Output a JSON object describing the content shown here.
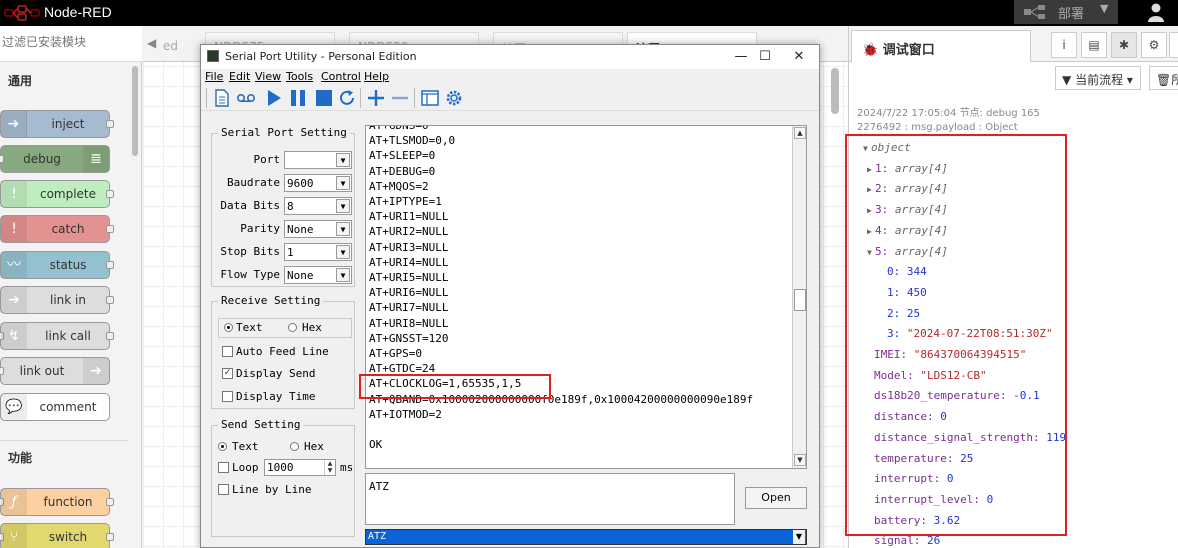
{
  "app": {
    "title": "Node-RED",
    "deploy_label": "部署"
  },
  "palette": {
    "search_placeholder": "过滤已安装模块",
    "categories": [
      "通用",
      "功能"
    ],
    "nodes": [
      {
        "label": "inject",
        "color": "#a6bbcf"
      },
      {
        "label": "debug",
        "color": "#87a980"
      },
      {
        "label": "complete",
        "color": "#c0edc0"
      },
      {
        "label": "catch",
        "color": "#e49191"
      },
      {
        "label": "status",
        "color": "#94c1d0"
      },
      {
        "label": "link in",
        "color": "#dddddd"
      },
      {
        "label": "link call",
        "color": "#dddddd"
      },
      {
        "label": "link out",
        "color": "#dddddd"
      },
      {
        "label": "comment",
        "color": "#ffffff"
      },
      {
        "label": "function",
        "color": "#fdd0a2"
      },
      {
        "label": "switch",
        "color": "#e2d96e"
      }
    ]
  },
  "workspace": {
    "tabs": [
      "ed",
      "NDDS75",
      "NDDS20",
      "地图",
      "流程 2"
    ]
  },
  "serial_window": {
    "title": "Serial Port Utility - Personal Edition",
    "menus": [
      "File",
      "Edit",
      "View",
      "Tools",
      "Control",
      "Help"
    ],
    "serial_port_setting": {
      "title": "Serial Port Setting",
      "port_label": "Port",
      "port_value": "",
      "baudrate_label": "Baudrate",
      "baudrate_value": "9600",
      "databits_label": "Data Bits",
      "databits_value": "8",
      "parity_label": "Parity",
      "parity_value": "None",
      "stopbits_label": "Stop Bits",
      "stopbits_value": "1",
      "flowtype_label": "Flow Type",
      "flowtype_value": "None"
    },
    "receive_setting": {
      "title": "Receive Setting",
      "text_label": "Text",
      "hex_label": "Hex",
      "auto_feed_label": "Auto Feed Line",
      "display_send_label": "Display Send",
      "display_time_label": "Display Time"
    },
    "send_setting": {
      "title": "Send Setting",
      "text_label": "Text",
      "hex_label": "Hex",
      "loop_label": "Loop",
      "loop_value": "1000",
      "ms_label": "ms",
      "line_by_line_label": "Line by Line"
    },
    "received_lines": [
      "AT+GDNS=0",
      "AT+TLSMOD=0,0",
      "AT+SLEEP=0",
      "AT+DEBUG=0",
      "AT+MQOS=2",
      "AT+IPTYPE=1",
      "AT+URI1=NULL",
      "AT+URI2=NULL",
      "AT+URI3=NULL",
      "AT+URI4=NULL",
      "AT+URI5=NULL",
      "AT+URI6=NULL",
      "AT+URI7=NULL",
      "AT+URI8=NULL",
      "AT+GNSST=120",
      "AT+GPS=0",
      "AT+GTDC=24",
      "AT+CLOCKLOG=1,65535,1,5",
      "AT+QBAND=0x100002000000000f0e189f,0x10004200000000090e189f",
      "AT+IOTMOD=2",
      "",
      "OK"
    ],
    "send_text": "ATZ",
    "open_label": "Open",
    "command_value": "ATZ"
  },
  "debug_sidebar": {
    "tab_title": "调试窗口",
    "filter_label": "当前流程",
    "clear_label": "所",
    "timestamp": "2024/7/22 17:05:04",
    "node_label": "节点: debug 165",
    "msg_meta": "2276492 : msg.payload : Object",
    "root": "object",
    "arrays": [
      {
        "key": "1:",
        "type": "array[4]"
      },
      {
        "key": "2:",
        "type": "array[4]"
      },
      {
        "key": "3:",
        "type": "array[4]"
      },
      {
        "key": "4:",
        "type": "array[4]"
      },
      {
        "key": "5:",
        "type": "array[4]"
      }
    ],
    "expanded": [
      {
        "key": "0:",
        "value": "344"
      },
      {
        "key": "1:",
        "value": "450"
      },
      {
        "key": "2:",
        "value": "25"
      },
      {
        "key": "3:",
        "value": "\"2024-07-22T08:51:30Z\""
      }
    ],
    "fields": [
      {
        "key": "IMEI:",
        "value": "\"864370064394515\"",
        "kind": "str"
      },
      {
        "key": "Model:",
        "value": "\"LDS12-CB\"",
        "kind": "str"
      },
      {
        "key": "ds18b20_temperature:",
        "value": "-0.1",
        "kind": "num"
      },
      {
        "key": "distance:",
        "value": "0",
        "kind": "num"
      },
      {
        "key": "distance_signal_strength:",
        "value": "119",
        "kind": "num"
      },
      {
        "key": "temperature:",
        "value": "25",
        "kind": "num"
      },
      {
        "key": "interrupt:",
        "value": "0",
        "kind": "num"
      },
      {
        "key": "interrupt_level:",
        "value": "0",
        "kind": "num"
      },
      {
        "key": "battery:",
        "value": "3.62",
        "kind": "num"
      },
      {
        "key": "signal:",
        "value": "26",
        "kind": "num"
      }
    ]
  }
}
